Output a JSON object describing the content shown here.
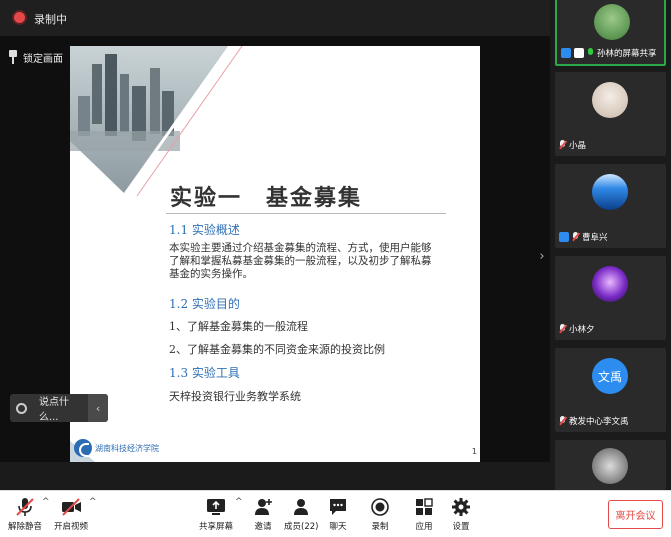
{
  "recording": {
    "label": "录制中"
  },
  "pin_screen": {
    "label": "锁定画面"
  },
  "slide": {
    "title": "实验一　基金募集",
    "section1": "1.1 实验概述",
    "paragraph": "本实验主要通过介绍基金募集的流程、方式，使用户能够了解和掌握私募基金募集的一般流程，以及初步了解私募基金的实务操作。",
    "section2": "1.2 实验目的",
    "goal1": "1、了解基金募集的一般流程",
    "goal2": "2、了解基金募集的不同资金来源的投资比例",
    "section3": "1.3 实验工具",
    "tool": "天梓投资银行业务教学系统",
    "logo_text": "湖南科技经济学院",
    "page_number": "1"
  },
  "chat_float": {
    "label": "说点什么..."
  },
  "participants": [
    {
      "name": "孙林的屏幕共享",
      "active": true
    },
    {
      "name": "小晶"
    },
    {
      "name": "曹阜兴"
    },
    {
      "name": "小林夕"
    },
    {
      "name": "教发中心李文禹",
      "avatar_text": "文禹"
    },
    {
      "name": ""
    }
  ],
  "toolbar": {
    "mute": "解除静音",
    "video": "开启视频",
    "share": "共享屏幕",
    "invite": "邀请",
    "members": "成员(22)",
    "chat": "聊天",
    "record": "录制",
    "apps": "应用",
    "settings": "设置",
    "leave": "离开会议"
  },
  "colors": {
    "accent_blue": "#2f6fb3",
    "danger": "#e34949",
    "active_green": "#2ba84a"
  }
}
